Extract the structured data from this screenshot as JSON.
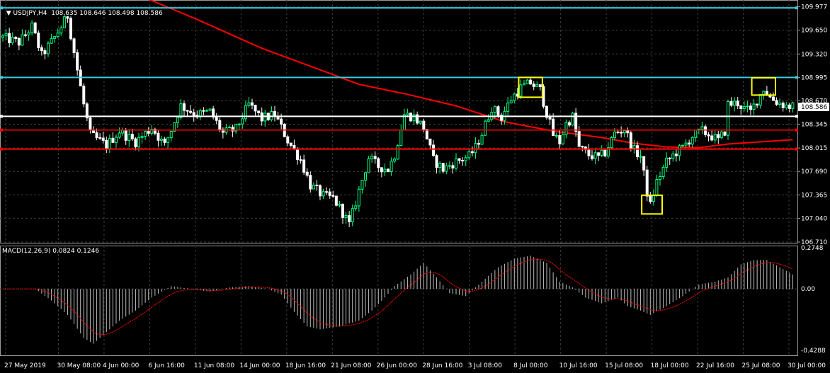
{
  "header": {
    "main": "USDJPY,H4  108.635 108.646 108.498 108.586",
    "macd": "MACD(12,26,9) 0.0824 0.1246"
  },
  "colors": {
    "background": "#000000",
    "grid": "#3c3c3c",
    "bull": "#00ff7f",
    "bear": "#ffffff",
    "ma": "#ff0000",
    "level_cyan": "#40c8d8",
    "level_red": "#ff0000",
    "highlight": "#ffff00",
    "text": "#ffffff"
  },
  "chart_data": {
    "type": "candlestick",
    "symbol": "USDJPY",
    "timeframe": "H4",
    "price_axis": {
      "range": [
        106.7,
        110.05
      ],
      "labels": [
        "109.977",
        "109.650",
        "109.320",
        "108.995",
        "108.670",
        "108.345",
        "108.015",
        "107.690",
        "107.365",
        "107.040",
        "106.710"
      ],
      "current_price": "108.586"
    },
    "date_labels": [
      "27 May 2019",
      "30 May 08:00",
      "4 Jun 00:00",
      "6 Jun 16:00",
      "11 Jun 08:00",
      "14 Jun 00:00",
      "18 Jun 16:00",
      "21 Jun 08:00",
      "26 Jun 00:00",
      "28 Jun 16:00",
      "3 Jul 08:00",
      "8 Jul 00:00",
      "10 Jul 16:00",
      "15 Jul 08:00",
      "18 Jul 00:00",
      "22 Jul 16:00",
      "25 Jul 08:00",
      "30 Jul 00:00"
    ],
    "path_keypoints": [
      [
        0,
        109.55
      ],
      [
        5,
        109.48
      ],
      [
        9,
        109.7
      ],
      [
        12,
        109.3
      ],
      [
        16,
        109.55
      ],
      [
        20,
        109.85
      ],
      [
        23,
        109.1
      ],
      [
        25,
        108.62
      ],
      [
        27,
        108.2
      ],
      [
        32,
        108.05
      ],
      [
        36,
        108.25
      ],
      [
        41,
        108.1
      ],
      [
        46,
        108.3
      ],
      [
        50,
        108.05
      ],
      [
        55,
        108.6
      ],
      [
        60,
        108.48
      ],
      [
        64,
        108.52
      ],
      [
        68,
        108.22
      ],
      [
        72,
        108.28
      ],
      [
        76,
        108.62
      ],
      [
        80,
        108.42
      ],
      [
        84,
        108.48
      ],
      [
        88,
        108.12
      ],
      [
        92,
        107.85
      ],
      [
        95,
        107.5
      ],
      [
        99,
        107.35
      ],
      [
        102,
        107.32
      ],
      [
        105,
        107.12
      ],
      [
        107,
        106.95
      ],
      [
        110,
        107.42
      ],
      [
        113,
        107.88
      ],
      [
        116,
        107.76
      ],
      [
        119,
        107.72
      ],
      [
        121,
        107.92
      ],
      [
        124,
        108.48
      ],
      [
        127,
        108.45
      ],
      [
        130,
        108.3
      ],
      [
        133,
        107.85
      ],
      [
        136,
        107.72
      ],
      [
        140,
        107.83
      ],
      [
        144,
        107.9
      ],
      [
        146,
        108.02
      ],
      [
        148,
        108.22
      ],
      [
        151,
        108.58
      ],
      [
        154,
        108.44
      ],
      [
        157,
        108.7
      ],
      [
        160,
        108.85
      ],
      [
        163,
        108.92
      ],
      [
        166,
        108.82
      ],
      [
        168,
        108.5
      ],
      [
        170,
        108.2
      ],
      [
        172,
        108.1
      ],
      [
        174,
        108.35
      ],
      [
        176,
        108.45
      ],
      [
        178,
        108.02
      ],
      [
        181,
        107.92
      ],
      [
        184,
        107.88
      ],
      [
        186,
        107.95
      ],
      [
        189,
        108.22
      ],
      [
        192,
        108.28
      ],
      [
        195,
        107.98
      ],
      [
        197,
        107.9
      ],
      [
        199,
        107.4
      ],
      [
        200,
        107.22
      ],
      [
        202,
        107.55
      ],
      [
        205,
        107.82
      ],
      [
        208,
        107.96
      ],
      [
        210,
        108.02
      ],
      [
        213,
        108.18
      ],
      [
        216,
        108.25
      ],
      [
        219,
        108.18
      ],
      [
        221,
        108.12
      ],
      [
        223,
        108.25
      ],
      [
        224,
        108.62
      ],
      [
        227,
        108.64
      ],
      [
        229,
        108.56
      ],
      [
        231,
        108.52
      ],
      [
        233,
        108.68
      ],
      [
        235,
        108.84
      ],
      [
        237,
        108.72
      ],
      [
        239,
        108.66
      ],
      [
        242,
        108.6
      ],
      [
        244,
        108.59
      ]
    ],
    "macd_path_keypoints": [
      [
        0,
        0.0
      ],
      [
        10,
        0.0
      ],
      [
        15,
        -0.08
      ],
      [
        20,
        -0.18
      ],
      [
        25,
        -0.34
      ],
      [
        28,
        -0.38
      ],
      [
        32,
        -0.3
      ],
      [
        36,
        -0.22
      ],
      [
        41,
        -0.15
      ],
      [
        46,
        -0.06
      ],
      [
        52,
        0.02
      ],
      [
        58,
        0.0
      ],
      [
        64,
        -0.02
      ],
      [
        70,
        0.01
      ],
      [
        76,
        0.02
      ],
      [
        82,
        0.0
      ],
      [
        86,
        -0.04
      ],
      [
        90,
        -0.16
      ],
      [
        94,
        -0.26
      ],
      [
        98,
        -0.28
      ],
      [
        104,
        -0.26
      ],
      [
        110,
        -0.22
      ],
      [
        114,
        -0.15
      ],
      [
        118,
        -0.06
      ],
      [
        121,
        0.02
      ],
      [
        126,
        0.1
      ],
      [
        130,
        0.18
      ],
      [
        134,
        0.08
      ],
      [
        138,
        -0.03
      ],
      [
        143,
        -0.05
      ],
      [
        148,
        0.05
      ],
      [
        153,
        0.15
      ],
      [
        158,
        0.21
      ],
      [
        163,
        0.23
      ],
      [
        168,
        0.18
      ],
      [
        172,
        0.05
      ],
      [
        176,
        0.01
      ],
      [
        180,
        -0.06
      ],
      [
        185,
        -0.1
      ],
      [
        190,
        -0.06
      ],
      [
        193,
        -0.12
      ],
      [
        197,
        -0.15
      ],
      [
        200,
        -0.18
      ],
      [
        205,
        -0.12
      ],
      [
        210,
        -0.05
      ],
      [
        215,
        0.03
      ],
      [
        220,
        0.05
      ],
      [
        224,
        0.08
      ],
      [
        228,
        0.17
      ],
      [
        232,
        0.2
      ],
      [
        236,
        0.2
      ],
      [
        240,
        0.15
      ],
      [
        244,
        0.1
      ]
    ],
    "macd_axis": {
      "range": [
        -0.46,
        0.3
      ],
      "labels": [
        "0.2748",
        "0.00",
        "-0.4288"
      ]
    },
    "horizontal_levels": [
      {
        "price": 109.96,
        "color": "cyan",
        "width": 2
      },
      {
        "price": 108.995,
        "color": "cyan",
        "width": 2
      },
      {
        "price": 108.455,
        "color": "white",
        "width": 2
      },
      {
        "price": 108.265,
        "color": "red",
        "width": 1.5
      },
      {
        "price": 108.0,
        "color": "red",
        "width": 2
      }
    ],
    "highlight_boxes": [
      {
        "bar_from": 160,
        "bar_to": 166,
        "price_from": 108.72,
        "price_to": 108.995
      },
      {
        "bar_from": 198,
        "bar_to": 203,
        "price_from": 107.1,
        "price_to": 107.36
      },
      {
        "bar_from": 232,
        "bar_to": 238,
        "price_from": 108.75,
        "price_to": 108.99
      }
    ],
    "moving_average": [
      [
        0,
        111.0
      ],
      [
        45,
        110.08
      ],
      [
        60,
        109.8
      ],
      [
        80,
        109.4
      ],
      [
        95,
        109.15
      ],
      [
        110,
        108.9
      ],
      [
        125,
        108.76
      ],
      [
        140,
        108.6
      ],
      [
        155,
        108.38
      ],
      [
        170,
        108.25
      ],
      [
        185,
        108.16
      ],
      [
        195,
        108.08
      ],
      [
        205,
        108.03
      ],
      [
        215,
        108.02
      ],
      [
        224,
        108.07
      ],
      [
        244,
        108.13
      ]
    ]
  }
}
